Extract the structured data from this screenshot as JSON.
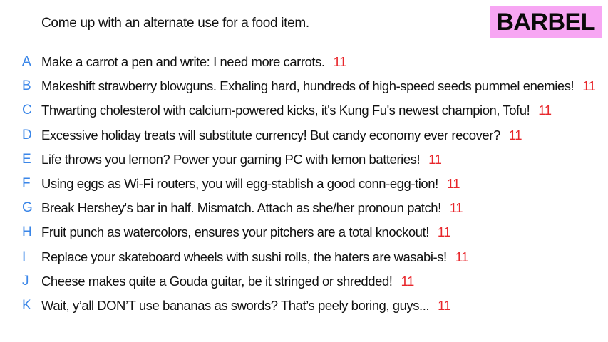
{
  "prompt": "Come up with an alternate use for a food item.",
  "badge": "BARBEL",
  "colors": {
    "letter": "#3a86e8",
    "score": "#e8262b",
    "badge_bg": "#f7a6f3"
  },
  "answers": [
    {
      "letter": "A",
      "text": "Make a carrot a pen and write: I need more carrots.",
      "score": "11"
    },
    {
      "letter": "B",
      "text": "Makeshift strawberry blowguns. Exhaling hard, hundreds of high-speed seeds pummel enemies!",
      "score": "11"
    },
    {
      "letter": "C",
      "text": "Thwarting cholesterol with calcium-powered kicks, it's Kung Fu's newest champion, Tofu!",
      "score": "11"
    },
    {
      "letter": "D",
      "text": "Excessive holiday treats will substitute currency! But candy economy ever recover?",
      "score": "11"
    },
    {
      "letter": "E",
      "text": "Life throws you lemon? Power your gaming PC with lemon batteries!",
      "score": "11"
    },
    {
      "letter": "F",
      "text": "Using eggs as Wi-Fi routers, you will egg-stablish a good conn-egg-tion!",
      "score": "11"
    },
    {
      "letter": "G",
      "text": "Break Hershey's bar in half. Mismatch. Attach as she/her pronoun patch!",
      "score": "11"
    },
    {
      "letter": "H",
      "text": "Fruit punch as watercolors, ensures your pitchers are a total knockout!",
      "score": "11"
    },
    {
      "letter": "I",
      "text": "Replace your skateboard wheels with sushi rolls, the haters are wasabi-s!",
      "score": "11"
    },
    {
      "letter": "J",
      "text": "Cheese makes quite a Gouda guitar, be it stringed or shredded!",
      "score": "11"
    },
    {
      "letter": "K",
      "text": "Wait, y’all DON’T use bananas as swords? That’s peely boring, guys...",
      "score": "11"
    }
  ]
}
